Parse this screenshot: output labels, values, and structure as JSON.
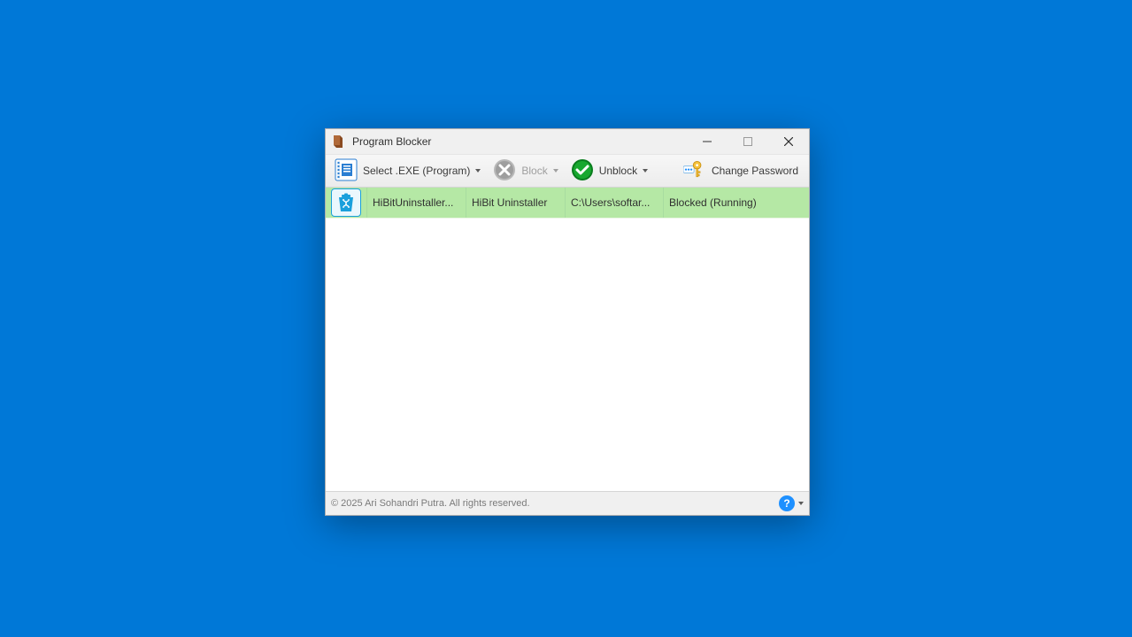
{
  "window": {
    "title": "Program Blocker"
  },
  "toolbar": {
    "select_label": "Select .EXE (Program)",
    "block_label": "Block",
    "unblock_label": "Unblock",
    "change_password_label": "Change Password"
  },
  "rows": [
    {
      "file": "HiBitUninstaller...",
      "name": "HiBit Uninstaller",
      "path": "C:\\Users\\softar...",
      "status": "Blocked (Running)"
    }
  ],
  "statusbar": {
    "copyright": "© 2025 Ari Sohandri Putra. All rights reserved."
  }
}
